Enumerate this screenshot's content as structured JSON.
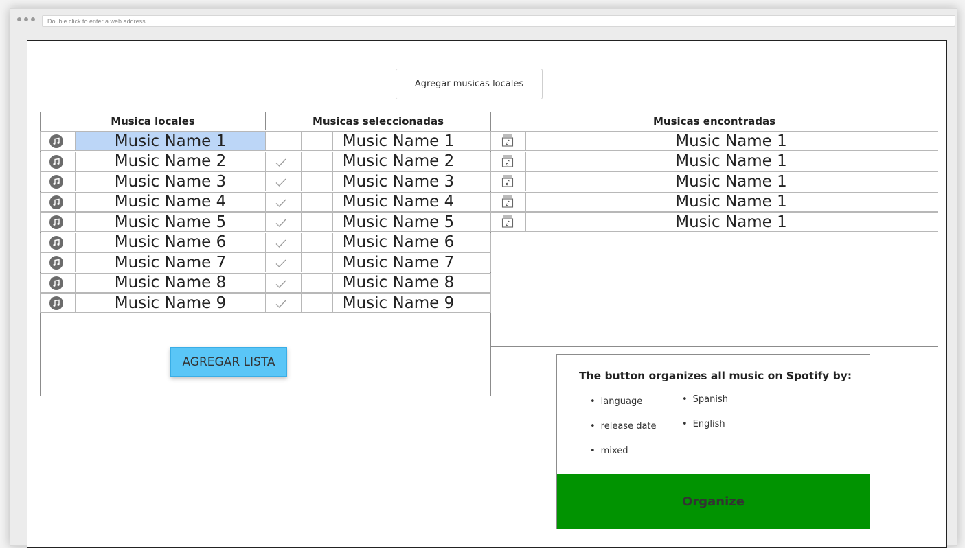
{
  "browser": {
    "address_placeholder": "Double click to enter a web address"
  },
  "toolbar": {
    "add_local_label": "Agregar musicas locales"
  },
  "headers": {
    "local": "Musica locales",
    "selected": "Musicas seleccionadas",
    "found": "Musicas encontradas"
  },
  "local_tracks": [
    "Music Name 1",
    "Music Name 2",
    "Music Name 3",
    "Music Name 4",
    "Music Name 5",
    "Music Name 6",
    "Music Name 7",
    "Music Name 8",
    "Music Name 9"
  ],
  "selected_tracks": [
    "Music Name 1",
    "Music Name 2",
    "Music Name 3",
    "Music Name 4",
    "Music Name 5",
    "Music Name 6",
    "Music Name 7",
    "Music Name 8",
    "Music Name 9"
  ],
  "found_tracks": [
    "Music Name 1",
    "Music Name 1",
    "Music Name 1",
    "Music Name 1",
    "Music Name 1"
  ],
  "agregar_lista_label": "AGREGAR LISTA",
  "organize": {
    "title": "The button organizes all music on Spotify by:",
    "criteria": [
      "language",
      "release date",
      "mixed"
    ],
    "languages": [
      "Spanish",
      "English"
    ],
    "button_label": "Organize"
  },
  "colors": {
    "selected_row": "#bcd6f7",
    "agregar_button": "#5ac6f7",
    "organize_button": "#019301"
  },
  "icons": {
    "local_row": "music-note-icon",
    "selected_row": "checkmark-icon",
    "found_row": "album-icon"
  }
}
